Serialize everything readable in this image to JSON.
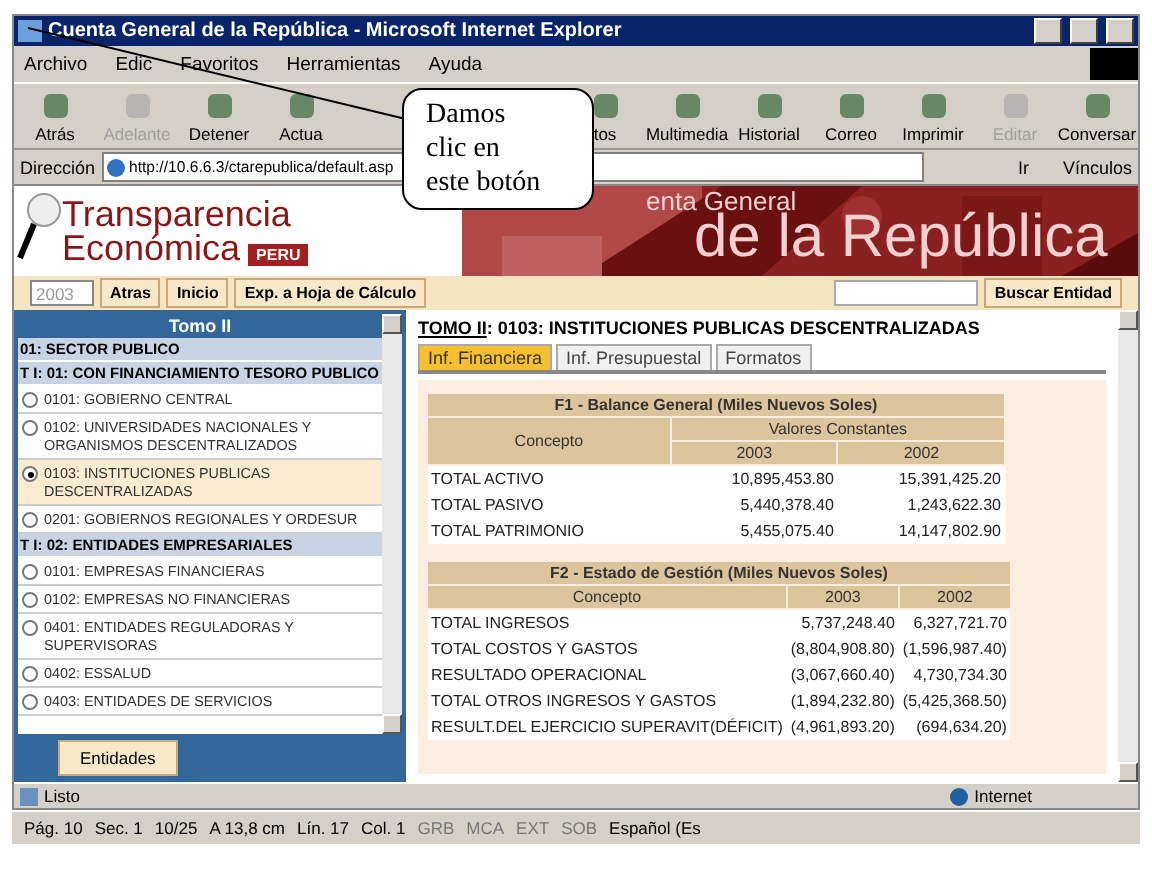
{
  "window": {
    "title": "Cuenta General de la República - Microsoft Internet Explorer"
  },
  "menu": [
    "Archivo",
    "Edic",
    "Favoritos",
    "Herramientas",
    "Ayuda"
  ],
  "toolbar_left": [
    {
      "label": "Atrás",
      "disabled": false
    },
    {
      "label": "Adelante",
      "disabled": true
    },
    {
      "label": "Detener",
      "disabled": false
    },
    {
      "label": "Actua",
      "disabled": false
    }
  ],
  "toolbar_right": [
    {
      "label": "tos",
      "disabled": false
    },
    {
      "label": "Multimedia",
      "disabled": false
    },
    {
      "label": "Historial",
      "disabled": false
    },
    {
      "label": "Correo",
      "disabled": false
    },
    {
      "label": "Imprimir",
      "disabled": false
    },
    {
      "label": "Editar",
      "disabled": true
    },
    {
      "label": "Conversar",
      "disabled": false
    }
  ],
  "address": {
    "label": "Dirección",
    "value": "http://10.6.6.3/ctarepublica/default.asp",
    "go": "Ir",
    "links": "Vínculos"
  },
  "callout": {
    "text": "Damos clic en este botón"
  },
  "banner": {
    "logo_line1": "Transparencia",
    "logo_line2": "Económica",
    "logo_badge": "PERU",
    "title_small": "enta General",
    "title_large": "de la República"
  },
  "actions": {
    "year": "2003",
    "buttons": [
      "Atras",
      "Inicio",
      "Exp. a Hoja de Cálculo"
    ],
    "search_button": "Buscar Entidad"
  },
  "sidebar": {
    "title": "Tomo II",
    "sector": "01: SECTOR PUBLICO",
    "groups": [
      {
        "label": "T I: 01: CON FINANCIAMIENTO TESORO PUBLICO",
        "items": [
          {
            "label": "0101: GOBIERNO CENTRAL",
            "selected": false
          },
          {
            "label": "0102: UNIVERSIDADES NACIONALES Y ORGANISMOS DESCENTRALIZADOS",
            "selected": false
          },
          {
            "label": "0103: INSTITUCIONES PUBLICAS DESCENTRALIZADAS",
            "selected": true
          },
          {
            "label": "0201: GOBIERNOS REGIONALES Y ORDESUR",
            "selected": false
          }
        ]
      },
      {
        "label": "T I: 02: ENTIDADES EMPRESARIALES",
        "items": [
          {
            "label": "0101: EMPRESAS FINANCIERAS",
            "selected": false
          },
          {
            "label": "0102: EMPRESAS NO FINANCIERAS",
            "selected": false
          },
          {
            "label": "0401: ENTIDADES REGULADORAS Y SUPERVISORAS",
            "selected": false
          },
          {
            "label": "0402: ESSALUD",
            "selected": false
          },
          {
            "label": "0403: ENTIDADES DE SERVICIOS",
            "selected": false
          }
        ]
      }
    ],
    "button": "Entidades"
  },
  "content": {
    "heading_link": "TOMO II",
    "heading_rest": ": 0103: INSTITUCIONES PUBLICAS DESCENTRALIZADAS",
    "tabs": [
      {
        "label": "Inf. Financiera",
        "selected": true
      },
      {
        "label": "Inf. Presupuestal",
        "selected": false
      },
      {
        "label": "Formatos",
        "selected": false
      }
    ],
    "balance": {
      "title": "F1 - Balance General (Miles Nuevos Soles)",
      "concept": "Concepto",
      "group": "Valores Constantes",
      "years": [
        "2003",
        "2002"
      ],
      "rows": [
        [
          "TOTAL ACTIVO",
          "10,895,453.80",
          "15,391,425.20"
        ],
        [
          "TOTAL PASIVO",
          "5,440,378.40",
          "1,243,622.30"
        ],
        [
          "TOTAL PATRIMONIO",
          "5,455,075.40",
          "14,147,802.90"
        ]
      ]
    },
    "gestion": {
      "title": "F2 - Estado de Gestión (Miles Nuevos Soles)",
      "concept": "Concepto",
      "years": [
        "2003",
        "2002"
      ],
      "rows": [
        [
          "TOTAL INGRESOS",
          "5,737,248.40",
          "6,327,721.70"
        ],
        [
          "TOTAL COSTOS Y GASTOS",
          "(8,804,908.80)",
          "(1,596,987.40)"
        ],
        [
          "RESULTADO OPERACIONAL",
          "(3,067,660.40)",
          "4,730,734.30"
        ],
        [
          "TOTAL OTROS INGRESOS Y GASTOS",
          "(1,894,232.80)",
          "(5,425,368.50)"
        ],
        [
          "RESULT.DEL EJERCICIO SUPERAVIT(DÉFICIT)",
          "(4,961,893.20)",
          "(694,634.20)"
        ]
      ]
    }
  },
  "status_bar": {
    "text": "Listo",
    "zone": "Internet"
  },
  "word_status": [
    {
      "label": "Pág. 10",
      "disabled": false
    },
    {
      "label": "Sec. 1",
      "disabled": false
    },
    {
      "label": "10/25",
      "disabled": false
    },
    {
      "label": "A 13,8 cm",
      "disabled": false
    },
    {
      "label": "Lín. 17",
      "disabled": false
    },
    {
      "label": "Col. 1",
      "disabled": false
    },
    {
      "label": "GRB",
      "disabled": true
    },
    {
      "label": "MCA",
      "disabled": true
    },
    {
      "label": "EXT",
      "disabled": true
    },
    {
      "label": "SOB",
      "disabled": true
    },
    {
      "label": "Español (Es",
      "disabled": false
    }
  ]
}
